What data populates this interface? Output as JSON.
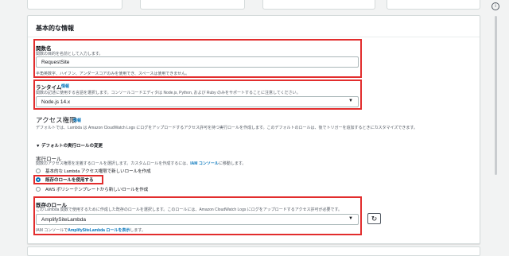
{
  "panel": {
    "title": "基本的な情報"
  },
  "function_name": {
    "label": "関数名",
    "description": "関数の目的を名前として入力します。",
    "value": "RequestSite",
    "hint": "半角英数字、ハイフン、アンダースコアのみを使用でき、スペースは使用できません。"
  },
  "runtime": {
    "label": "ランタイム",
    "info": "情報",
    "description": "関数の記述に使用する言語を選択します。コンソールコードエディタは Node.js, Python, および Ruby のみをサポートすることに注意してください。",
    "value": "Node.js 14.x"
  },
  "access": {
    "title": "アクセス権限",
    "info": "情報",
    "description": "デフォルトでは、Lambda は Amazon CloudWatch Logs にログをアップロードするアクセス許可を持つ実行ロールを作成します。このデフォルトのロールは、後でトリガーを追加するときにカスタマイズできます。",
    "expander": "デフォルトの実行ロールの変更",
    "exec_role_label": "実行ロール",
    "exec_role_desc_prefix": "関数のアクセス権限を定義するロールを選択します。カスタムロールを作成するには、",
    "exec_role_desc_link": "IAM コンソール",
    "exec_role_desc_suffix": "に移動します。",
    "options": [
      {
        "label": "基本的な Lambda アクセス権限で新しいロールを作成",
        "selected": false
      },
      {
        "label": "既存のロールを使用する",
        "selected": true
      },
      {
        "label": "AWS ポリシーテンプレートから新しいロールを作成",
        "selected": false
      }
    ]
  },
  "existing_role": {
    "label": "既存のロール",
    "description": "この Lambda 関数で使用するために作成した既存のロールを選択します。このロールには、Amazon CloudWatch Logs にログをアップロードするアクセス許可が必要です。",
    "value": "AmplifySiteLambda",
    "footer_prefix": "IAM コンソールで",
    "footer_link": "AmplifySiteLambda ロールを表示",
    "footer_suffix": "します。"
  },
  "colors": {
    "highlight": "#e22d2d",
    "link": "#0073bb",
    "radio_selected": "#0073bb"
  }
}
